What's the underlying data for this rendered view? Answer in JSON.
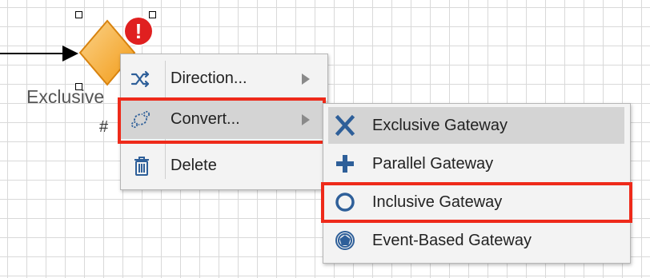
{
  "diagram": {
    "gateway_label": "Exclusive",
    "gateway_hash": "#",
    "warning_badge": "!"
  },
  "context_menu": {
    "items": [
      {
        "label": "Direction...",
        "icon": "shuffle-icon",
        "has_submenu": true
      },
      {
        "label": "Convert...",
        "icon": "convert-icon",
        "has_submenu": true,
        "highlighted": true
      },
      {
        "label": "Delete",
        "icon": "trash-icon",
        "has_submenu": false
      }
    ]
  },
  "convert_submenu": {
    "items": [
      {
        "label": "Exclusive Gateway",
        "icon": "x-icon",
        "selected": true
      },
      {
        "label": "Parallel Gateway",
        "icon": "plus-icon"
      },
      {
        "label": "Inclusive Gateway",
        "icon": "circle-icon",
        "highlighted": true
      },
      {
        "label": "Event-Based Gateway",
        "icon": "event-based-icon"
      }
    ]
  },
  "colors": {
    "accent_icon": "#2e5f99",
    "highlight_border": "#ee2a1a",
    "gateway_fill": "#f6a623",
    "badge": "#e02020",
    "grid": "#d9d9d9"
  }
}
